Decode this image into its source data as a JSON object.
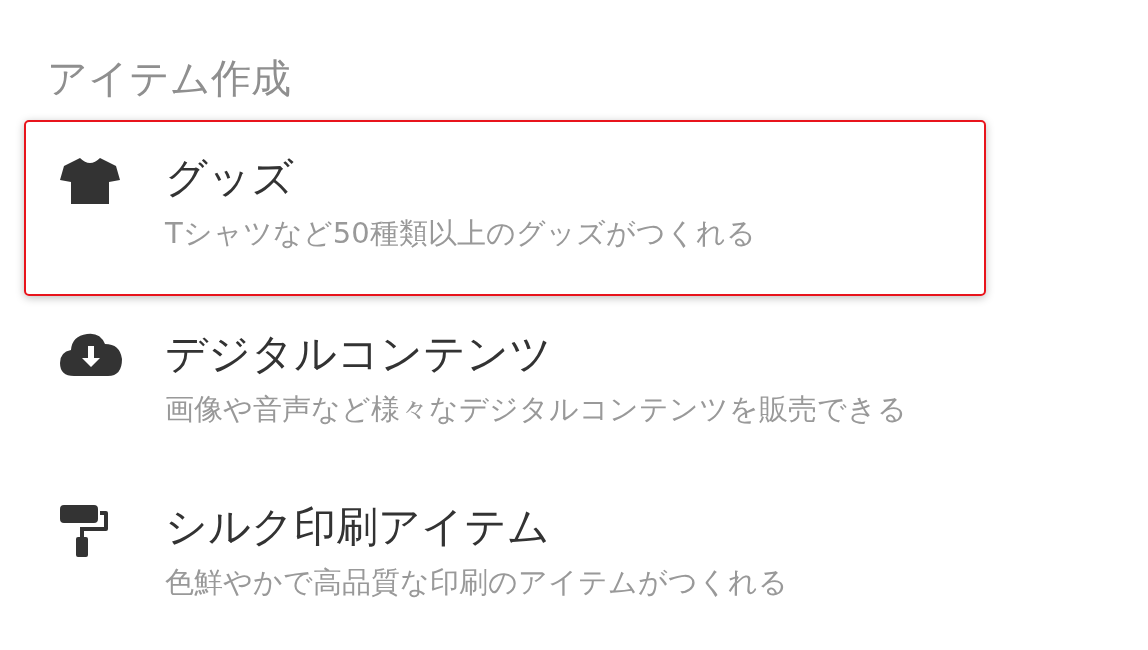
{
  "heading": "アイテム作成",
  "items": [
    {
      "kind": "tshirt",
      "title": "グッズ",
      "subtitle": "Tシャツなど50種類以上のグッズがつくれる",
      "selected": true
    },
    {
      "kind": "cloud",
      "title": "デジタルコンテンツ",
      "subtitle": "画像や音声など様々なデジタルコンテンツを販売できる",
      "selected": false
    },
    {
      "kind": "roller",
      "title": "シルク印刷アイテム",
      "subtitle": "色鮮やかで高品質な印刷のアイテムがつくれる",
      "selected": false
    }
  ]
}
